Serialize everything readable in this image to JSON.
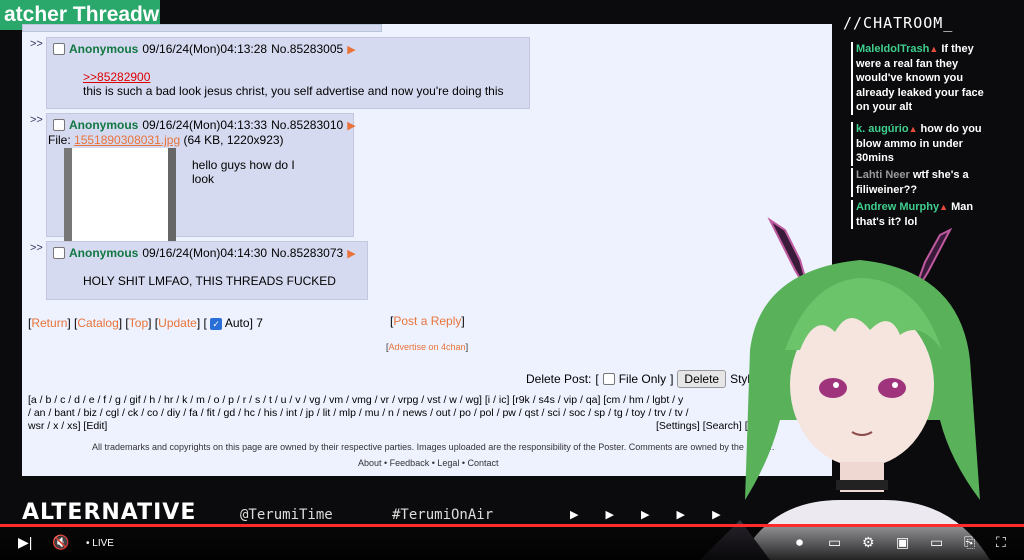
{
  "banner": {
    "title": "atcher Threadw"
  },
  "posts": [
    {
      "arrows": ">>",
      "name": "Anonymous",
      "datetime": "09/16/24(Mon)04:13:28",
      "number": "No.85283005",
      "quote": ">>85282900",
      "message": "this is such a bad look jesus christ, you self advertise and now you're doing this"
    },
    {
      "arrows": ">>",
      "name": "Anonymous",
      "datetime": "09/16/24(Mon)04:13:33",
      "number": "No.85283010",
      "file_label": "File:",
      "file_name": "1551890308031.jpg",
      "file_meta": "(64 KB, 1220x923)",
      "message_line1": "hello guys how do I",
      "message_line2": "look"
    },
    {
      "arrows": ">>",
      "name": "Anonymous",
      "datetime": "09/16/24(Mon)04:14:30",
      "number": "No.85283073",
      "message": "HOLY SHIT LMFAO, THIS THREADS FUCKED"
    }
  ],
  "thread_nav": {
    "return": "Return",
    "catalog": "Catalog",
    "top": "Top",
    "update": "Update",
    "auto": "Auto",
    "count": "7",
    "post_reply": "Post a Reply",
    "advertise": "Advertise on 4chan"
  },
  "delete_bar": {
    "label": "Delete Post:",
    "file_only": "File Only",
    "delete_button": "Delete",
    "style": "Style:"
  },
  "boards": {
    "line1": "[a / b / c / d / e / f / g / gif / h / hr / k / m / o / p / r / s / t / u / v / vg / vm / vmg / vr / vrpg / vst / w / wg] [i / ic] [r9k / s4s / vip / qa] [cm / hm / lgbt / y",
    "line2": "/ an / bant / biz / cgl / ck / co / diy / fa / fit / gd / hc / his / int / jp / lit / mlp / mu / n / news / out / po / pol / pw / qst / sci / soc / sp / tg / toy / trv / tv /",
    "line3": "wsr / x / xs] [Edit]",
    "settings": "[Settings] [Search] [",
    "footer": "All trademarks and copyrights on this page are owned by their respective parties. Images uploaded are the responsibility of the Poster. Comments are owned by the Poster.",
    "footer_links": "About • Feedback • Legal • Contact"
  },
  "chat": {
    "title": "//CHATROOM_",
    "messages": [
      {
        "user": "MaleIdolTrash",
        "text": " If they were a real fan they would've known you already leaked your face on your alt"
      },
      {
        "user": "k. augúrio",
        "text": " how do you blow ammo in under 30mins"
      },
      {
        "user": "Lahti Neer",
        "text": " wtf she's a filiweiner??"
      },
      {
        "user": "Andrew Murphy",
        "text": " Man that's it? lol"
      }
    ]
  },
  "overlay": {
    "brand": "ALTERNATIVE",
    "tag1": "@TerumiTime",
    "tag2": "#TerumiOnAir",
    "arrows": "▶ ▶ ▶ ▶ ▶"
  },
  "player": {
    "live": "LIVE",
    "accent_color": "#ff2a2a"
  }
}
